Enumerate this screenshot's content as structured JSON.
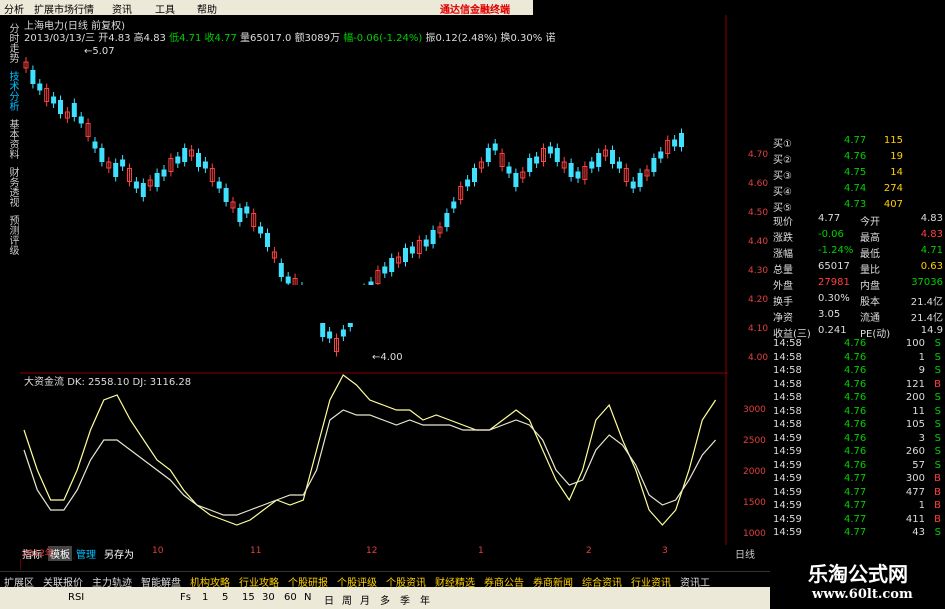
{
  "menu": {
    "items": [
      "分析",
      "扩展市场行情",
      "资讯",
      "工具",
      "帮助"
    ],
    "promo": "通达信金融终端"
  },
  "side_tabs": [
    "分时走势",
    "技术分析",
    "基本资料",
    "财务透视",
    "预测评级"
  ],
  "stock": {
    "name": "上海电力(日线 前复权)",
    "info": {
      "date": "2013/03/13/三",
      "open": "开4.83",
      "high": "高4.83",
      "low": "低4.71",
      "close": "收4.77",
      "vol": "量65017.0",
      "amt": "额3089万",
      "chg": "幅-0.06(-1.24%)",
      "amp": "振0.12(2.48%)",
      "turn": "换0.30%",
      "extra": "诺"
    }
  },
  "price_chart": {
    "high_label": "5.07",
    "low_label": "4.00",
    "y_ticks": [
      "4.70",
      "4.60",
      "4.50",
      "4.40",
      "4.30",
      "4.20",
      "4.10",
      "4.00"
    ]
  },
  "indicator": {
    "name": "大资金流",
    "dk": "DK: 2558.10",
    "dj": "DJ: 3116.28",
    "y_ticks": [
      "3000",
      "2500",
      "2000",
      "1500",
      "1000"
    ]
  },
  "x_axis": {
    "labels": [
      "2012年",
      "10",
      "11",
      "12",
      "1",
      "2",
      "3"
    ],
    "right_label": "日线"
  },
  "bottom_tabs": {
    "items": [
      "指标",
      "模板",
      "管理",
      "另存为"
    ]
  },
  "quote": {
    "bids": [
      {
        "label": "买①",
        "price": "4.77",
        "vol": "115"
      },
      {
        "label": "买②",
        "price": "4.76",
        "vol": "19"
      },
      {
        "label": "买③",
        "price": "4.75",
        "vol": "14"
      },
      {
        "label": "买④",
        "price": "4.74",
        "vol": "274"
      },
      {
        "label": "买⑤",
        "price": "4.73",
        "vol": "407"
      }
    ],
    "stats": [
      {
        "l1": "现价",
        "v1": "4.77",
        "l2": "今开",
        "v2": "4.83"
      },
      {
        "l1": "涨跌",
        "v1": "-0.06",
        "l2": "最高",
        "v2": "4.83"
      },
      {
        "l1": "涨幅",
        "v1": "-1.24%",
        "l2": "最低",
        "v2": "4.71"
      },
      {
        "l1": "总量",
        "v1": "65017",
        "l2": "量比",
        "v2": "0.63"
      },
      {
        "l1": "外盘",
        "v1": "27981",
        "l2": "内盘",
        "v2": "37036"
      },
      {
        "l1": "换手",
        "v1": "0.30%",
        "l2": "股本",
        "v2": "21.4亿"
      },
      {
        "l1": "净资",
        "v1": "3.05",
        "l2": "流通",
        "v2": "21.4亿"
      },
      {
        "l1": "收益(三)",
        "v1": "0.241",
        "l2": "PE(动)",
        "v2": "14.9"
      }
    ],
    "ticks": [
      {
        "t": "14:58",
        "p": "4.76",
        "v": "100",
        "s": "S"
      },
      {
        "t": "14:58",
        "p": "4.76",
        "v": "1",
        "s": "S"
      },
      {
        "t": "14:58",
        "p": "4.76",
        "v": "9",
        "s": "S"
      },
      {
        "t": "14:58",
        "p": "4.76",
        "v": "121",
        "s": "B"
      },
      {
        "t": "14:58",
        "p": "4.76",
        "v": "200",
        "s": "S"
      },
      {
        "t": "14:58",
        "p": "4.76",
        "v": "11",
        "s": "S"
      },
      {
        "t": "14:58",
        "p": "4.76",
        "v": "105",
        "s": "S"
      },
      {
        "t": "14:59",
        "p": "4.76",
        "v": "3",
        "s": "S"
      },
      {
        "t": "14:59",
        "p": "4.76",
        "v": "260",
        "s": "S"
      },
      {
        "t": "14:59",
        "p": "4.76",
        "v": "57",
        "s": "S"
      },
      {
        "t": "14:59",
        "p": "4.77",
        "v": "300",
        "s": "B"
      },
      {
        "t": "14:59",
        "p": "4.77",
        "v": "477",
        "s": "B"
      },
      {
        "t": "14:59",
        "p": "4.77",
        "v": "1",
        "s": "B"
      },
      {
        "t": "14:59",
        "p": "4.77",
        "v": "411",
        "s": "B"
      },
      {
        "t": "14:59",
        "p": "4.77",
        "v": "43",
        "s": "S"
      }
    ]
  },
  "func_bar": {
    "items": [
      "扩展区",
      "关联报价",
      "主力轨迹",
      "智能解盘",
      "机构攻略",
      "行业攻略",
      "个股研报",
      "个股评级",
      "个股资讯",
      "财经精选",
      "券商公告",
      "券商新闻",
      "综合资讯",
      "行业资讯",
      "资讯工"
    ]
  },
  "toolbar": {
    "items": [
      "RSI",
      "Fs",
      "1",
      "5",
      "15",
      "30",
      "60",
      "N",
      "日",
      "周",
      "月",
      "多",
      "季",
      "年"
    ]
  },
  "watermark": {
    "line1": "乐淘公式网",
    "line2": "www.60lt.com"
  }
}
